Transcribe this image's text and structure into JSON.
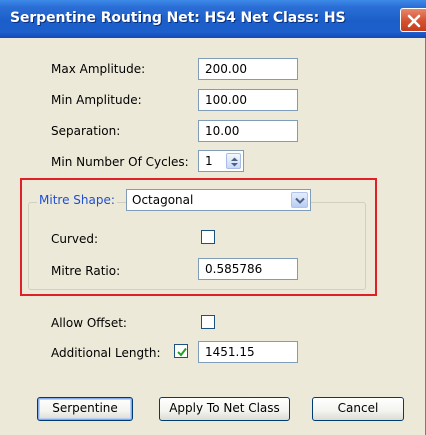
{
  "window": {
    "title": "Serpentine Routing Net: HS4 Net Class: HS",
    "close_icon": "close-icon"
  },
  "fields": {
    "max_amplitude": {
      "label": "Max Amplitude:",
      "value": "200.00"
    },
    "min_amplitude": {
      "label": "Min Amplitude:",
      "value": "100.00"
    },
    "separation": {
      "label": "Separation:",
      "value": "10.00"
    },
    "min_cycles": {
      "label": "Min Number Of Cycles:",
      "value": "1"
    }
  },
  "mitre": {
    "shape_label": "Mitre Shape:",
    "shape_value": "Octagonal",
    "curved_label": "Curved:",
    "curved_checked": false,
    "ratio_label": "Mitre Ratio:",
    "ratio_value": "0.585786"
  },
  "options": {
    "allow_offset_label": "Allow Offset:",
    "allow_offset_checked": false,
    "additional_length_label": "Additional Length:",
    "additional_length_checked": true,
    "additional_length_value": "1451.15"
  },
  "buttons": {
    "serpentine": "Serpentine",
    "apply": "Apply To Net Class",
    "cancel": "Cancel"
  },
  "colors": {
    "titlebar": "#1d5fcb",
    "highlight_border": "#e01f26",
    "group_label": "#1e4fd3",
    "dialog_bg": "#ece9d8"
  }
}
